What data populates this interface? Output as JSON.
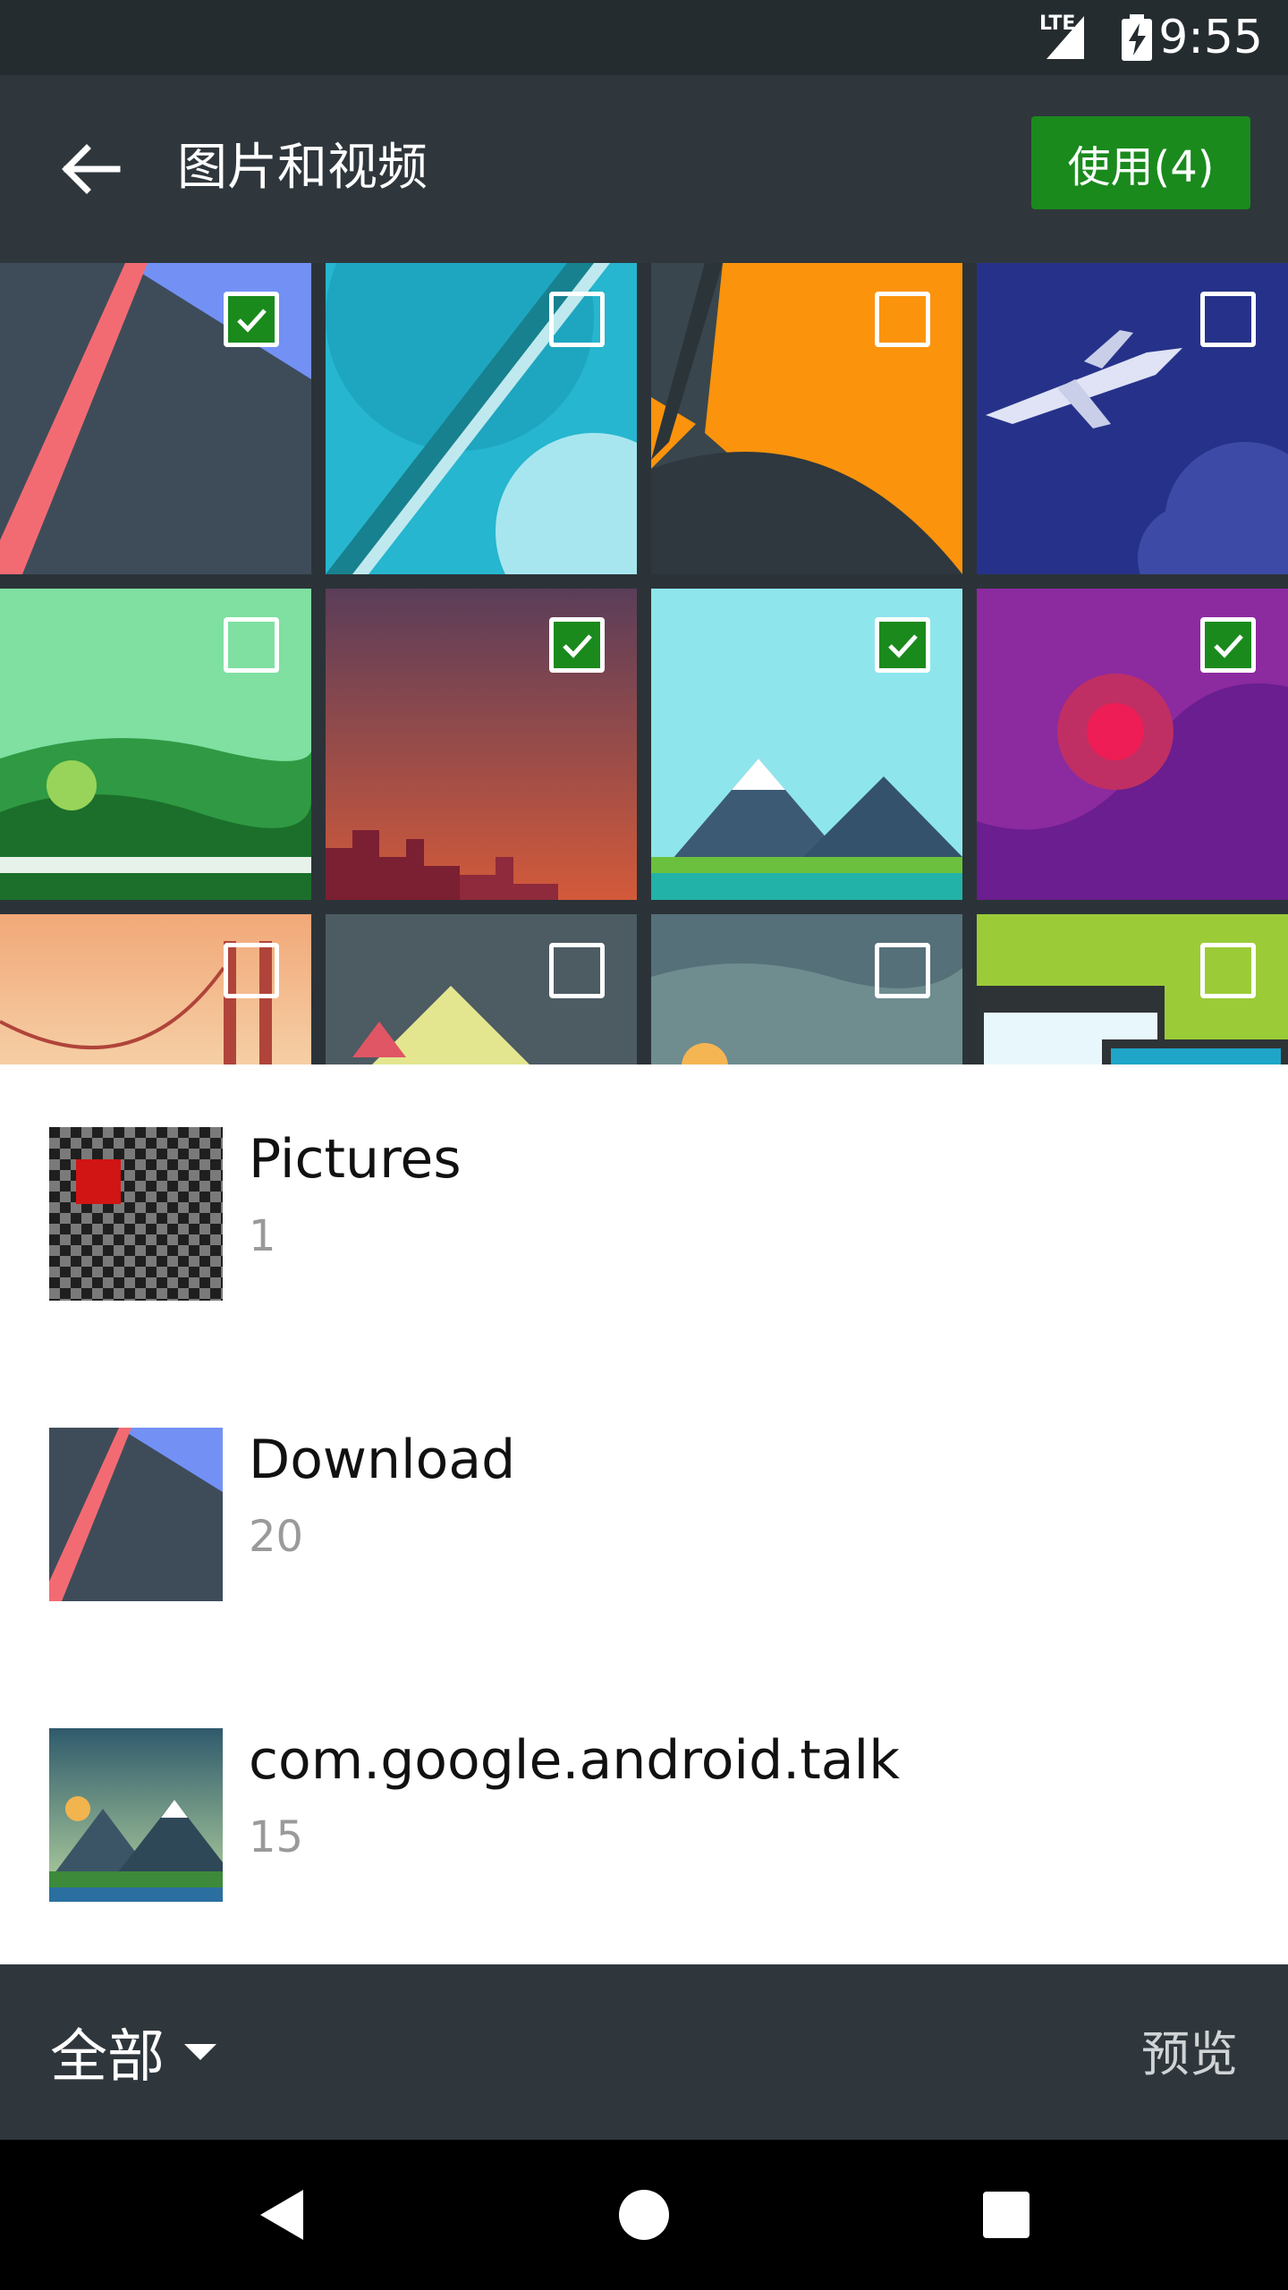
{
  "status_bar": {
    "network": "LTE",
    "time": "9:55"
  },
  "app_bar": {
    "title": "图片和视频",
    "use_button": "使用(4)"
  },
  "grid": {
    "tiles": [
      {
        "art": "red-diagonal-wallpaper",
        "checked": true
      },
      {
        "art": "teal-circles-wallpaper",
        "checked": false
      },
      {
        "art": "orange-arc-wallpaper",
        "checked": false
      },
      {
        "art": "airplane-night-wallpaper",
        "checked": false
      },
      {
        "art": "green-forest-wallpaper",
        "checked": false
      },
      {
        "art": "city-sunset-wallpaper",
        "checked": true
      },
      {
        "art": "mountain-lake-wallpaper",
        "checked": true
      },
      {
        "art": "purple-sun-wallpaper",
        "checked": true
      },
      {
        "art": "golden-gate-wallpaper",
        "checked": false
      },
      {
        "art": "triangle-mountain-wallpaper",
        "checked": false
      },
      {
        "art": "dusk-hills-wallpaper",
        "checked": false
      },
      {
        "art": "laptop-green-wallpaper",
        "checked": false
      }
    ]
  },
  "albums": [
    {
      "name": "Pictures",
      "count": "1",
      "thumb": "checker-red-thumb"
    },
    {
      "name": "Download",
      "count": "20",
      "thumb": "red-diagonal-thumb"
    },
    {
      "name": "com.google.android.talk",
      "count": "15",
      "thumb": "mountain-thumb"
    }
  ],
  "toolbar": {
    "filter_label": "全部",
    "preview_label": "预览"
  },
  "colors": {
    "accent": "#1a8a1d",
    "app_bar": "#2f373c",
    "status_bar": "#252c30"
  }
}
